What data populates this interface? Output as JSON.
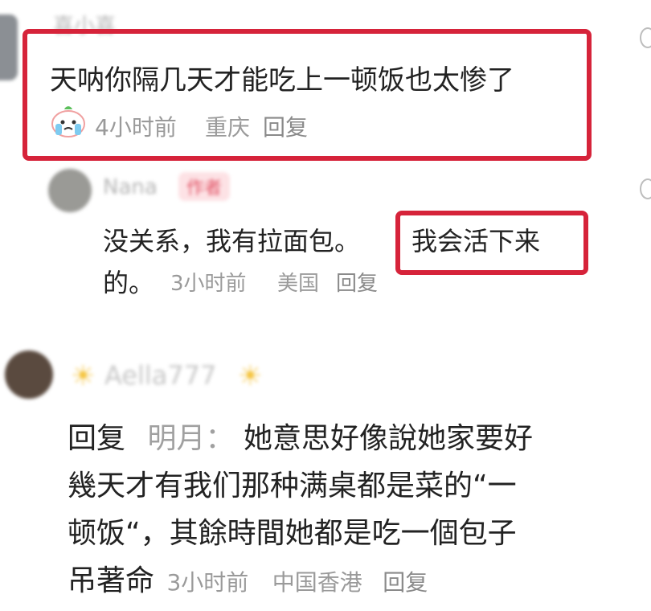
{
  "comment1": {
    "username": "喜小喜",
    "text": "天呐你隔几天才能吃上一顿饭也太惨了",
    "time": "4小时前",
    "location": "重庆",
    "reply": "回复"
  },
  "reply1": {
    "username": "Nana",
    "badge": "作者",
    "text_a": "没关系，我有拉面包。",
    "text_b": "我会活下来",
    "text_c": "的。",
    "time": "3小时前",
    "location": "美国",
    "reply": "回复"
  },
  "comment2": {
    "username": "Aella777",
    "reply_prefix": "回复",
    "reply_to": "明月：",
    "line1": "她意思好像說她家要好",
    "line2": "幾天才有我们那种满桌都是菜的“一",
    "line3": "顿饭“，其餘時間她都是吃一個包子",
    "line4": "吊著命",
    "time": "3小时前",
    "location": "中国香港",
    "reply": "回复"
  },
  "colors": {
    "highlight": "#d6233a",
    "meta": "#9a9a9a",
    "badge_bg": "#fde2e5",
    "badge_text": "#e25668"
  },
  "icons": [
    "crying-face-icon",
    "like-icon"
  ]
}
